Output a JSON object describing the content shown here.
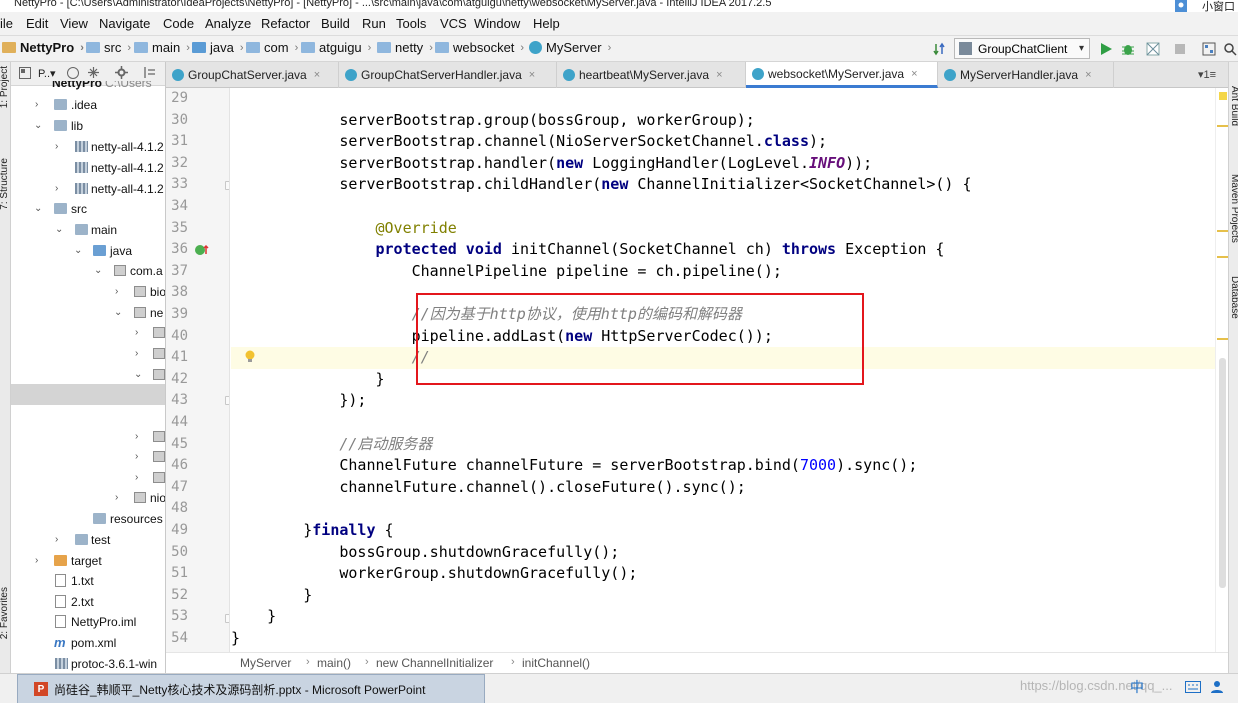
{
  "window": {
    "title": "NettyPro - [C:\\Users\\Administrator\\IdeaProjects\\NettyPro] - [NettyPro] - ...\\src\\main\\java\\com\\atguigu\\netty\\websocket\\MyServer.java - IntelliJ IDEA 2017.2.5",
    "corner_text": "小窗口"
  },
  "menu": [
    "ile",
    "Edit",
    "View",
    "Navigate",
    "Code",
    "Analyze",
    "Refactor",
    "Build",
    "Run",
    "Tools",
    "VCS",
    "Window",
    "Help"
  ],
  "navbar": {
    "crumbs": [
      "NettyPro",
      "src",
      "main",
      "java",
      "com",
      "atguigu",
      "netty",
      "websocket",
      "MyServer"
    ],
    "run_config": "GroupChatClient"
  },
  "project_panel": {
    "header_label": "P..▾",
    "header_path": "C:\\Users",
    "tree": [
      {
        "label": "NettyPro"
      },
      {
        "label": ".idea"
      },
      {
        "label": "lib"
      },
      {
        "label": "netty-all-4.1.2"
      },
      {
        "label": "netty-all-4.1.2"
      },
      {
        "label": "netty-all-4.1.2"
      },
      {
        "label": "src"
      },
      {
        "label": "main"
      },
      {
        "label": "java"
      },
      {
        "label": "com.a"
      },
      {
        "label": "bio"
      },
      {
        "label": "ne"
      },
      {
        "label": "nio"
      },
      {
        "label": "resources"
      },
      {
        "label": "test"
      },
      {
        "label": "target"
      },
      {
        "label": "1.txt"
      },
      {
        "label": "2.txt"
      },
      {
        "label": "NettyPro.iml"
      },
      {
        "label": "pom.xml"
      },
      {
        "label": "protoc-3.6.1-win"
      }
    ]
  },
  "left_stripe": {
    "project": "1: Project",
    "structure": "7: Structure",
    "favorites": "2: Favorites"
  },
  "right_stripe": {
    "ant": "Ant Build",
    "maven": "Maven Projects",
    "database": "Database"
  },
  "tabs": [
    {
      "label": "GroupChatServer.java"
    },
    {
      "label": "GroupChatServerHandler.java"
    },
    {
      "label": "heartbeat\\MyServer.java"
    },
    {
      "label": "websocket\\MyServer.java"
    },
    {
      "label": "MyServerHandler.java"
    }
  ],
  "tab_menu": "▾1≡",
  "editor": {
    "active_line": 41,
    "lines": [
      {
        "n": "29"
      },
      {
        "n": "30"
      },
      {
        "n": "31"
      },
      {
        "n": "32"
      },
      {
        "n": "33"
      },
      {
        "n": "34"
      },
      {
        "n": "35"
      },
      {
        "n": "36"
      },
      {
        "n": "37"
      },
      {
        "n": "38"
      },
      {
        "n": "39"
      },
      {
        "n": "40"
      },
      {
        "n": "41"
      },
      {
        "n": "42"
      },
      {
        "n": "43"
      },
      {
        "n": "44"
      },
      {
        "n": "45"
      },
      {
        "n": "46"
      },
      {
        "n": "47"
      },
      {
        "n": "48"
      },
      {
        "n": "49"
      },
      {
        "n": "50"
      },
      {
        "n": "51"
      },
      {
        "n": "52"
      },
      {
        "n": "53"
      },
      {
        "n": "54"
      }
    ],
    "code": {
      "l30": "            serverBootstrap.group(bossGroup, workerGroup);",
      "l31a": "            serverBootstrap.channel(NioServerSocketChannel.",
      "l31kw": "class",
      "l31b": ");",
      "l32a": "            serverBootstrap.handler(",
      "l32kw": "new",
      "l32b": " LoggingHandler(LogLevel.",
      "l32f": "INFO",
      "l32c": "));",
      "l33a": "            serverBootstrap.childHandler(",
      "l33kw": "new",
      "l33b": " ChannelInitializer<SocketChannel>() {",
      "l35": "                @Override",
      "l36ind": "                ",
      "l36kw1": "protected void",
      "l36b": " initChannel(SocketChannel ch) ",
      "l36kw2": "throws",
      "l36c": " Exception {",
      "l37": "                    ChannelPipeline pipeline = ch.pipeline();",
      "l39ind": "                    ",
      "l39c": "//因为基于http协议，使用http的编码和解码器",
      "l40a": "                    pipeline.addLast(",
      "l40kw": "new",
      "l40b": " HttpServerCodec());",
      "l41ind": "                    ",
      "l41c": "//",
      "l42": "                }",
      "l43": "            });",
      "l45ind": "            ",
      "l45c": "//启动服务器",
      "l46a": "            ChannelFuture channelFuture = serverBootstrap.bind(",
      "l46n": "7000",
      "l46b": ").sync();",
      "l47": "            channelFuture.channel().closeFuture().sync();",
      "l49a": "        }",
      "l49kw": "finally",
      "l49b": " {",
      "l50": "            bossGroup.shutdownGracefully();",
      "l51": "            workerGroup.shutdownGracefully();",
      "l52": "        }",
      "l53": "    }",
      "l54": "}"
    }
  },
  "breadcrumb": [
    "MyServer",
    "main()",
    "new ChannelInitializer",
    "initChannel()"
  ],
  "taskbar": {
    "item": "尚硅谷_韩顺平_Netty核心技术及源码剖析.pptx - Microsoft PowerPoint",
    "watermark": "https://blog.csdn.net/qq_..."
  },
  "colors": {
    "highlight_box": "#e3161c",
    "keyword": "#000080",
    "annotation": "#808000",
    "comment": "#808080",
    "number": "#0000ff"
  }
}
